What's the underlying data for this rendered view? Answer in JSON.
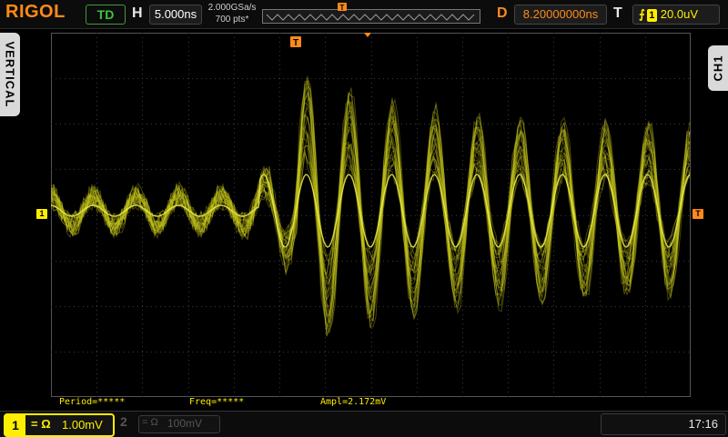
{
  "brand": "RIGOL",
  "top": {
    "run_status": "TD",
    "timebase_label": "H",
    "timebase_value": "5.000ns",
    "sample_rate": "2.000GSa/s",
    "memory_depth": "700 pts*",
    "delay_label": "D",
    "delay_value": "8.20000000ns",
    "trigger_label": "T",
    "trigger_channel": "1",
    "trigger_level": "20.0uV"
  },
  "side": {
    "left_tab": "VERTICAL",
    "right_tab": "CH1"
  },
  "markers": {
    "trigger_position": "T",
    "ch1_ground": "1",
    "trigger_level": "T"
  },
  "measurements": [
    {
      "label": "Period=*****"
    },
    {
      "label": "Freq=*****"
    },
    {
      "label": "Ampl=2.172mV"
    }
  ],
  "bottom": {
    "ch1_number": "1",
    "ch1_coupling_icons": "= Ω",
    "ch1_scale": "1.00mV",
    "ch2_number": "2",
    "ch2_coupling_icons": "= Ω",
    "ch2_scale": "100mV",
    "time": "17:16"
  },
  "colors": {
    "trace": "#c8c81e",
    "accent_orange": "#ff8a1a",
    "channel1_yellow": "#ffee00",
    "grid": "#3a3a3a"
  },
  "waveform": {
    "description_free": true,
    "cycles_per_screen": 15,
    "envelope_peak_fraction": 0.45
  }
}
